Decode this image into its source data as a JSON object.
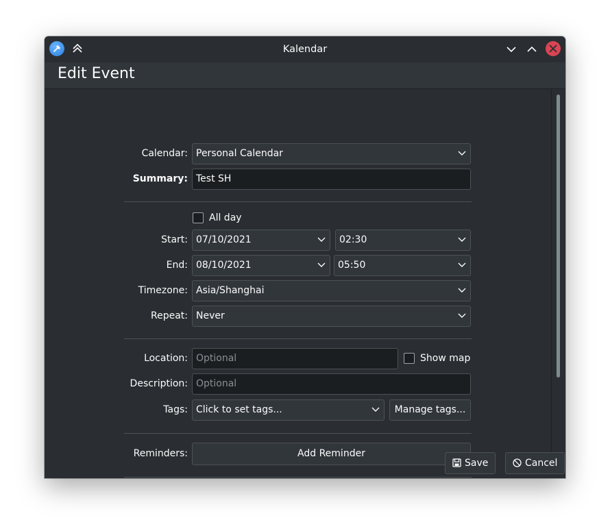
{
  "window": {
    "title": "Kalendar"
  },
  "header": {
    "title": "Edit Event"
  },
  "form": {
    "calendar": {
      "label": "Calendar:",
      "value": "Personal Calendar"
    },
    "summary": {
      "label": "Summary:",
      "value": "Test SH"
    },
    "all_day": {
      "label": "All day",
      "checked": false
    },
    "start": {
      "label": "Start:",
      "date": "07/10/2021",
      "time": "02:30"
    },
    "end": {
      "label": "End:",
      "date": "08/10/2021",
      "time": "05:50"
    },
    "timezone": {
      "label": "Timezone:",
      "value": "Asia/Shanghai"
    },
    "repeat": {
      "label": "Repeat:",
      "value": "Never"
    },
    "location": {
      "label": "Location:",
      "placeholder": "Optional",
      "show_map_label": "Show map",
      "show_map_checked": false
    },
    "description": {
      "label": "Description:",
      "placeholder": "Optional"
    },
    "tags": {
      "label": "Tags:",
      "value": "Click to set tags...",
      "manage_label": "Manage tags..."
    },
    "reminders": {
      "label": "Reminders:",
      "add_label": "Add Reminder"
    }
  },
  "footer": {
    "save_label": "Save",
    "cancel_label": "Cancel"
  },
  "colors": {
    "background": "#2a2e32",
    "close_button": "#da4453",
    "field_bg": "#1b1e20",
    "combo_bg": "#31363b",
    "app_icon": "#3d8ee8"
  },
  "icons": [
    "app-icon",
    "keep-above-icon",
    "minimize-icon",
    "maximize-icon",
    "close-icon",
    "chevron-down-icon",
    "save-icon",
    "cancel-icon"
  ]
}
